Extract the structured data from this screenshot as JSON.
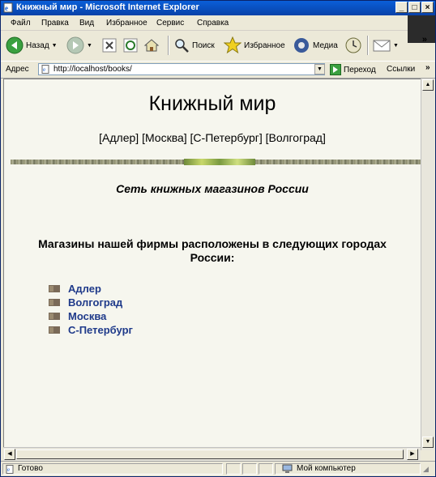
{
  "window": {
    "title": "Книжный мир - Microsoft Internet Explorer"
  },
  "menu": [
    "Файл",
    "Правка",
    "Вид",
    "Избранное",
    "Сервис",
    "Справка"
  ],
  "toolbar": {
    "back": "Назад",
    "search": "Поиск",
    "favorites": "Избранное",
    "media": "Медиа"
  },
  "address": {
    "label": "Адрес",
    "url": "http://localhost/books/",
    "go": "Переход",
    "links": "Ссылки"
  },
  "page": {
    "title": "Книжный мир",
    "nav": "[Адлер] [Москва] [С-Петербург] [Волгоград]",
    "tagline": "Сеть книжных магазинов России",
    "intro": "Магазины нашей фирмы расположены в следующих городах России:",
    "cities": [
      "Адлер",
      "Волгоград",
      "Москва",
      "С-Петербург"
    ]
  },
  "status": {
    "text": "Готово",
    "zone": "Мой компьютер"
  }
}
